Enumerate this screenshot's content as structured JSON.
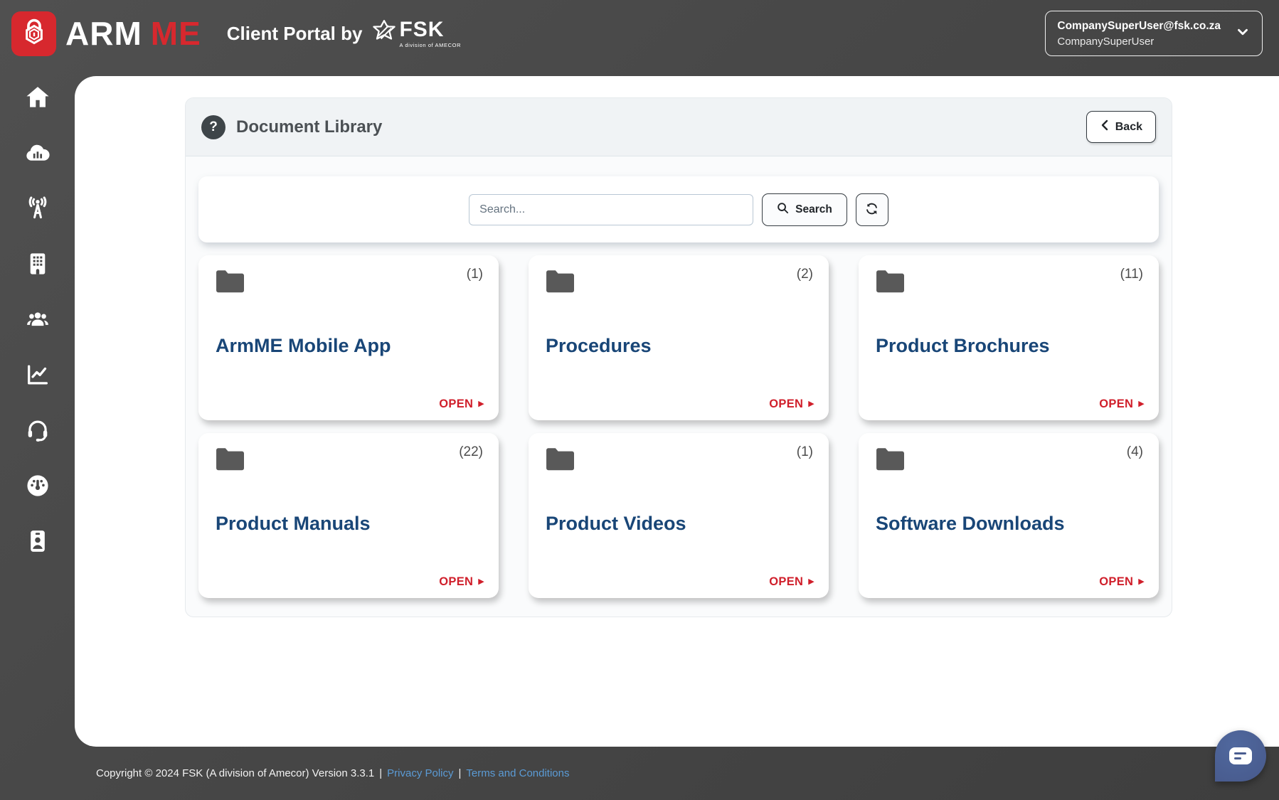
{
  "header": {
    "brand_arm": "ARM",
    "brand_me": "ME",
    "portal_title": "Client Portal by",
    "fsk_name": "FSK",
    "fsk_tagline": "A division of AMECOR",
    "user_email": "CompanySuperUser@fsk.co.za",
    "user_name": "CompanySuperUser"
  },
  "sidebar": {
    "icons": [
      "home",
      "cloud-analytics",
      "broadcast-tower",
      "building",
      "users-group",
      "chart-line",
      "headset",
      "gauge",
      "id-badge"
    ]
  },
  "library": {
    "title": "Document Library",
    "back_label": "Back",
    "search_placeholder": "Search...",
    "search_value": "",
    "search_button_label": "Search",
    "folders": [
      {
        "title": "ArmME Mobile App",
        "count": "(1)",
        "open_label": "OPEN",
        "open_arrow": "▶"
      },
      {
        "title": "Procedures",
        "count": "(2)",
        "open_label": "OPEN",
        "open_arrow": "▶"
      },
      {
        "title": "Product Brochures",
        "count": "(11)",
        "open_label": "OPEN",
        "open_arrow": "▶"
      },
      {
        "title": "Product Manuals",
        "count": "(22)",
        "open_label": "OPEN",
        "open_arrow": "▶"
      },
      {
        "title": "Product Videos",
        "count": "(1)",
        "open_label": "OPEN",
        "open_arrow": "▶"
      },
      {
        "title": "Software Downloads",
        "count": "(4)",
        "open_label": "OPEN",
        "open_arrow": "▶"
      }
    ],
    "help_glyph": "?"
  },
  "footer": {
    "copyright": "Copyright © 2024 FSK (A division of Amecor) Version 3.3.1",
    "sep1": "|",
    "privacy_label": "Privacy Policy",
    "sep2": "|",
    "terms_label": "Terms and Conditions"
  },
  "colors": {
    "brand_red": "#d7282e",
    "open_red": "#d01f2b",
    "title_navy": "#194677",
    "link_blue": "#5b9bd5",
    "chat_blue": "#4a5d90",
    "dark_bg": "#474747"
  }
}
